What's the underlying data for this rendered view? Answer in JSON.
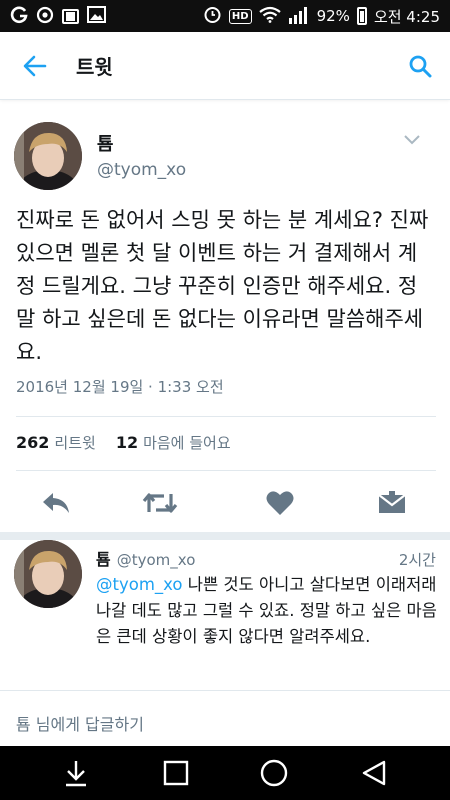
{
  "status_bar": {
    "battery": "92%",
    "time": "오전 4:25",
    "icons": [
      "g-icon",
      "brightness-icon",
      "notification-box-icon",
      "image-icon",
      "alarm-icon",
      "hd-icon",
      "wifi-icon",
      "signal-icon",
      "battery-icon"
    ]
  },
  "header": {
    "title": "트윗",
    "back_icon": "arrow-left-icon",
    "search_icon": "search-icon",
    "accent": "#1da1f2"
  },
  "main_tweet": {
    "name": "툠",
    "handle": "@tyom_xo",
    "text": "진짜로 돈 없어서 스밍 못 하는 분 계세요? 진짜 있으면 멜론 첫 달 이벤트 하는 거 결제해서 계정 드릴게요. 그냥 꾸준히 인증만 해주세요. 정말 하고 싶은데 돈 없다는 이유라면 말씀해주세요.",
    "timestamp": "2016년 12월 19일 · 1:33 오전",
    "retweets_count": "262",
    "retweets_label": "리트윗",
    "likes_count": "12",
    "likes_label": "마음에 들어요",
    "actions": [
      "reply-icon",
      "retweet-icon",
      "heart-icon",
      "message-icon"
    ]
  },
  "reply": {
    "name": "툠",
    "handle": "@tyom_xo",
    "time": "2시간",
    "mention": "@tyom_xo",
    "text": " 나쁜 것도 아니고 살다보면 이래저래 나갈 데도 많고 그럴 수 있죠. 정말 하고 싶은 마음은 큰데 상황이 좋지 않다면 알려주세요."
  },
  "reply_box": {
    "placeholder": "툠 님에게 답글하기"
  },
  "nav_bar": {
    "icons": [
      "download-icon",
      "recent-apps-icon",
      "home-icon",
      "back-icon"
    ]
  }
}
